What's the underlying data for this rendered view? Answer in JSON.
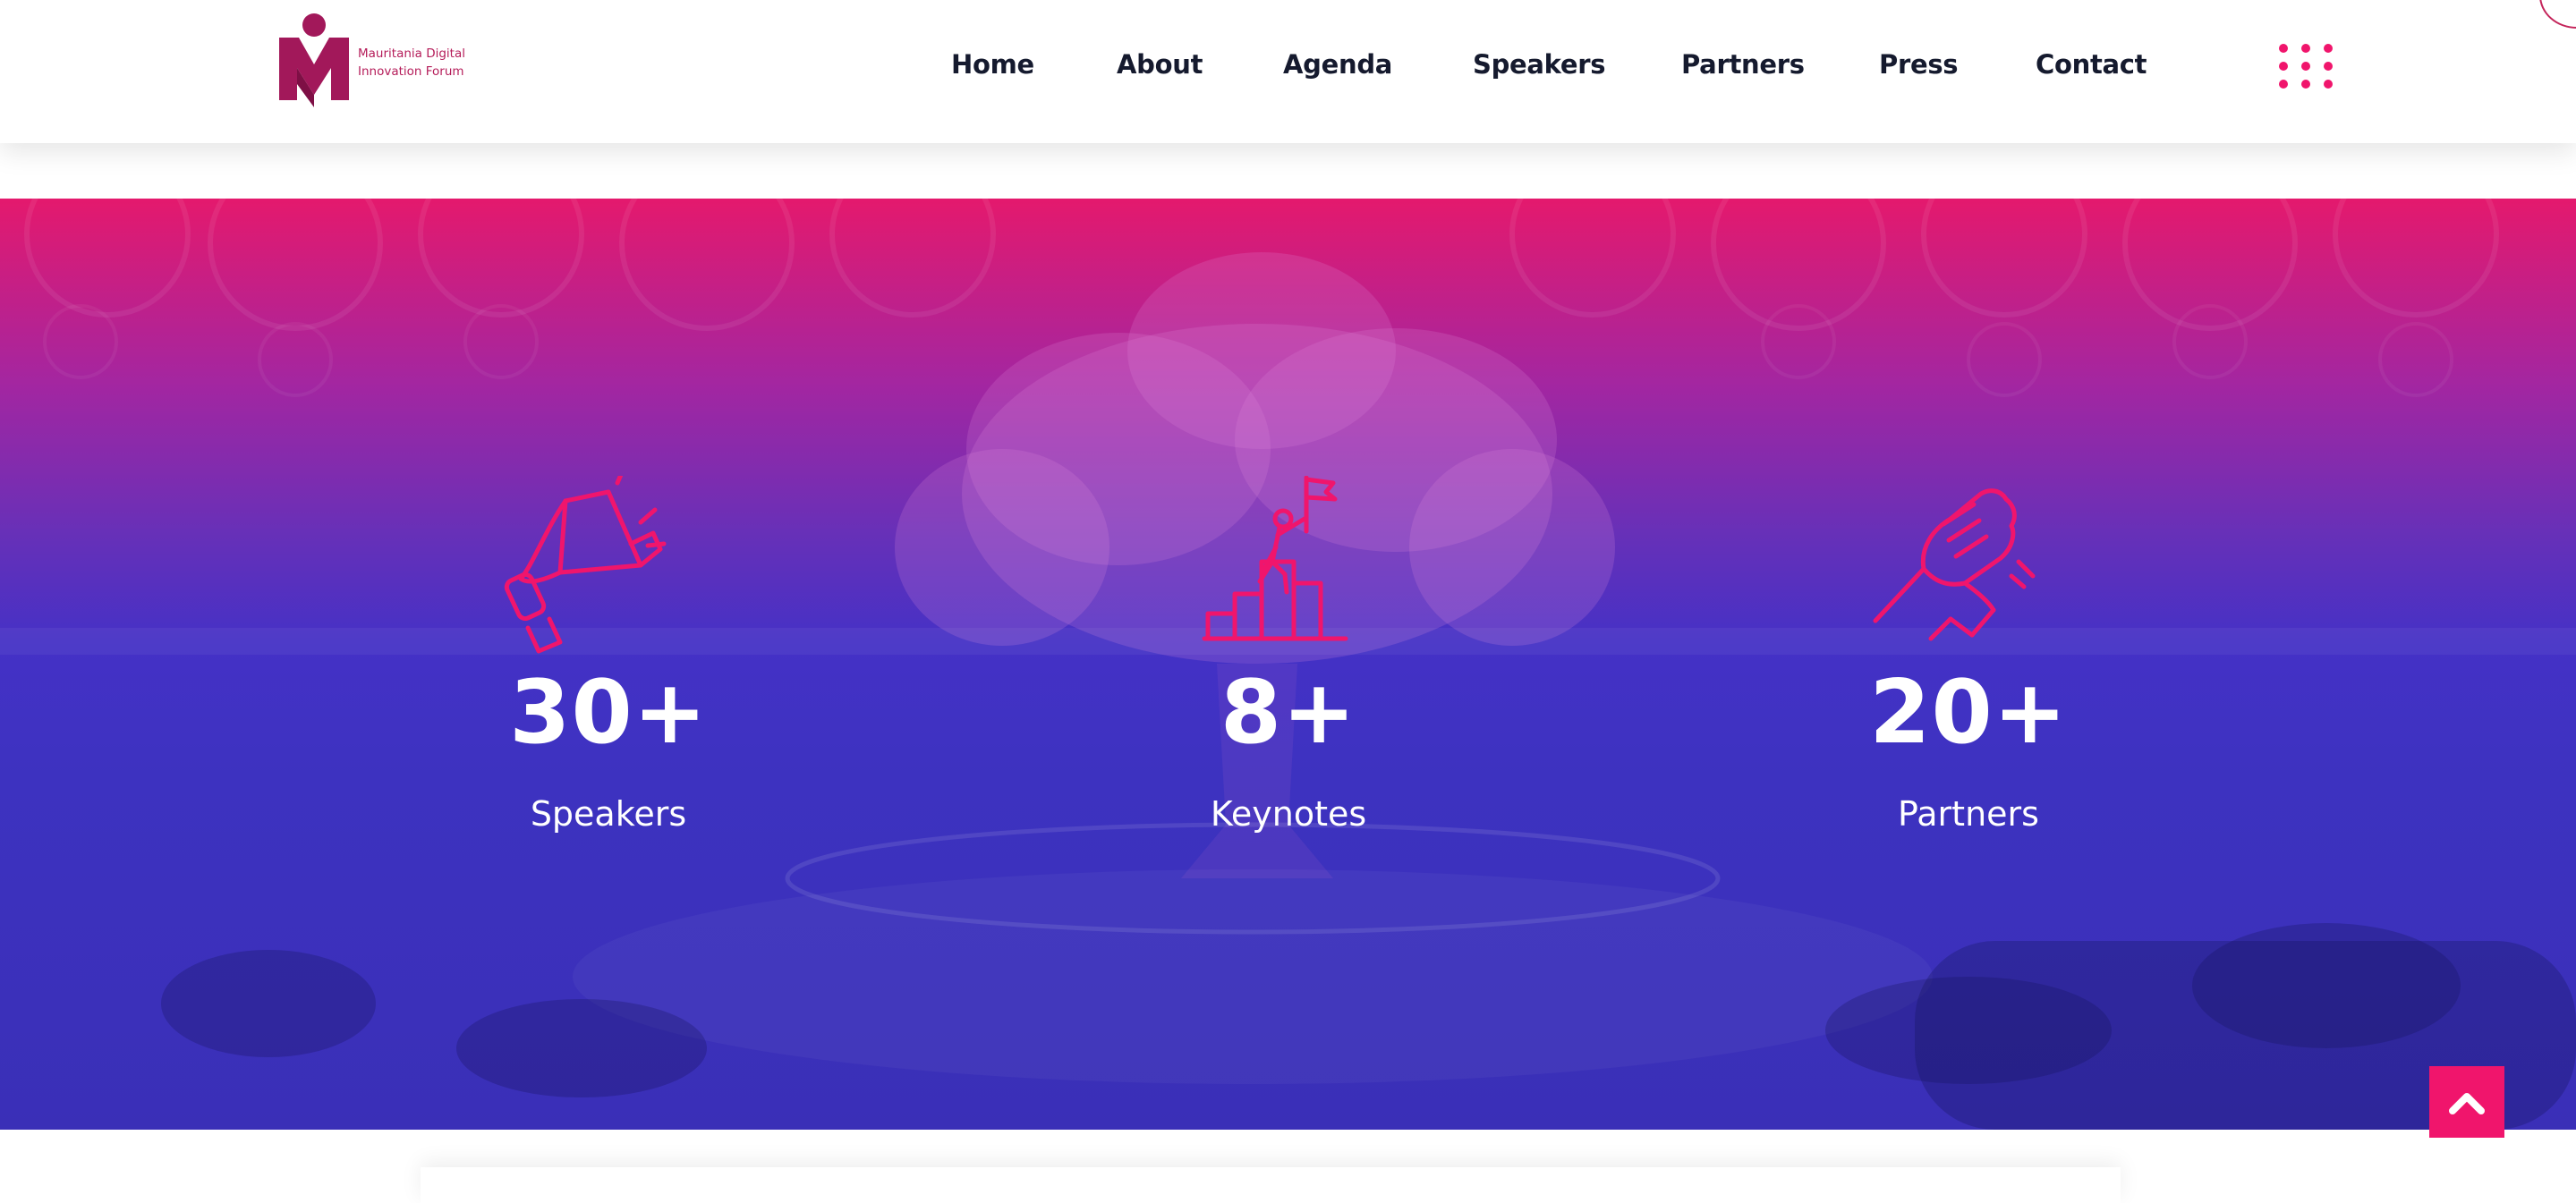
{
  "brand": {
    "name_line1": "Mauritania Digital",
    "name_line2": "Innovation Forum",
    "accent_color": "#e4196d",
    "logo_color": "#a2185a"
  },
  "nav": {
    "items": [
      {
        "label": "Home"
      },
      {
        "label": "About"
      },
      {
        "label": "Agenda"
      },
      {
        "label": "Speakers"
      },
      {
        "label": "Partners"
      },
      {
        "label": "Press"
      },
      {
        "label": "Contact"
      }
    ],
    "menu_icon": "grid-dots-icon"
  },
  "stats": {
    "items": [
      {
        "icon": "megaphone-icon",
        "number": "30+",
        "label": "Speakers"
      },
      {
        "icon": "summit-flag-icon",
        "number": "8+",
        "label": "Keynotes"
      },
      {
        "icon": "handshake-icon",
        "number": "20+",
        "label": "Partners"
      }
    ],
    "gradient": [
      "#e4196d",
      "#6730b8",
      "#3a2fb7"
    ]
  },
  "scroll_top": {
    "icon": "chevron-up-icon",
    "color": "#f0156c"
  }
}
